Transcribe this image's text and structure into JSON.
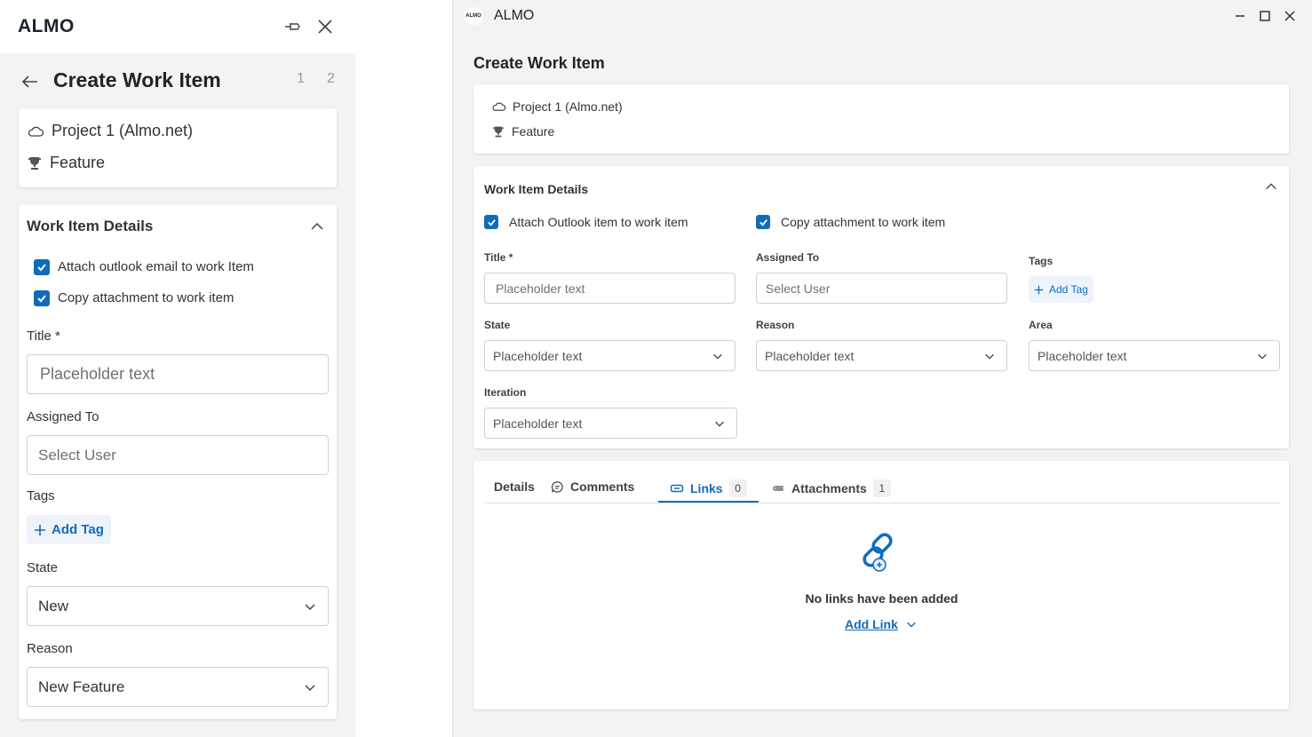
{
  "left_panel": {
    "logo": "ALMO",
    "title": "Create Work Item",
    "steps": [
      "1",
      "2"
    ],
    "project": "Project 1 (Almo.net)",
    "type": "Feature",
    "section_title": "Work Item Details",
    "checkbox_attach": "Attach outlook email to work Item",
    "checkbox_copy": "Copy attachment to work item",
    "title_label": "Title *",
    "title_placeholder": "Placeholder text",
    "assigned_label": "Assigned To",
    "assigned_placeholder": "Select User",
    "tags_label": "Tags",
    "add_tag": "Add Tag",
    "state_label": "State",
    "state_value": "New",
    "reason_label": "Reason",
    "reason_value": "New Feature"
  },
  "right_panel": {
    "app_name": "ALMO",
    "logo_text": "ALMO",
    "title": "Create Work Item",
    "project": "Project 1 (Almo.net)",
    "type": "Feature",
    "section_title": "Work Item Details",
    "checkbox_attach": "Attach Outlook item to work item",
    "checkbox_copy": "Copy attachment to work item",
    "title_label": "Title *",
    "title_placeholder": "Placeholder text",
    "assigned_label": "Assigned To",
    "assigned_placeholder": "Select User",
    "tags_label": "Tags",
    "add_tag": "Add Tag",
    "state_label": "State",
    "state_value": "Placeholder text",
    "reason_label": "Reason",
    "reason_value": "Placeholder text",
    "area_label": "Area",
    "area_value": "Placeholder text",
    "iteration_label": "Iteration",
    "iteration_value": "Placeholder text",
    "tabs": {
      "details": "Details",
      "comments": "Comments",
      "links": "Links",
      "links_count": "0",
      "attachments": "Attachments",
      "attachments_count": "1"
    },
    "empty_message": "No links have been added",
    "add_link": "Add Link"
  },
  "colors": {
    "accent": "#0f6cbd",
    "panel_bg": "#f3f3f5",
    "card_bg": "#ffffff"
  }
}
